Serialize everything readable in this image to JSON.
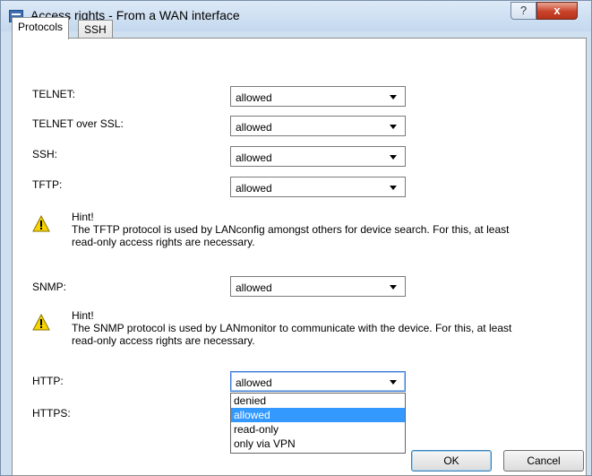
{
  "window": {
    "title": "Access rights - From a WAN interface",
    "help_label": "?",
    "close_label": "x"
  },
  "tabs": [
    {
      "label": "Protocols",
      "active": true
    },
    {
      "label": "SSH",
      "active": false
    }
  ],
  "fields": [
    {
      "label": "TELNET:",
      "value": "allowed"
    },
    {
      "label": "TELNET over SSL:",
      "value": "allowed"
    },
    {
      "label": "SSH:",
      "value": "allowed"
    },
    {
      "label": "TFTP:",
      "value": "allowed"
    },
    {
      "label": "SNMP:",
      "value": "allowed"
    },
    {
      "label": "HTTP:",
      "value": "allowed"
    },
    {
      "label": "HTTPS:",
      "value": ""
    }
  ],
  "hints": [
    {
      "title": "Hint!",
      "line1": "The TFTP protocol is used by LANconfig amongst others for device search. For this, at least",
      "line2": "read-only access rights are necessary."
    },
    {
      "title": "Hint!",
      "line1": "The SNMP protocol is used by LANmonitor to communicate with the device. For this, at least",
      "line2": "read-only access rights are necessary."
    }
  ],
  "dropdown": {
    "options": [
      "denied",
      "allowed",
      "read-only",
      "only via VPN"
    ],
    "selected": "allowed"
  },
  "buttons": {
    "ok": "OK",
    "cancel": "Cancel"
  },
  "colors": {
    "selection": "#3399ff",
    "warning": "#f5d400"
  }
}
